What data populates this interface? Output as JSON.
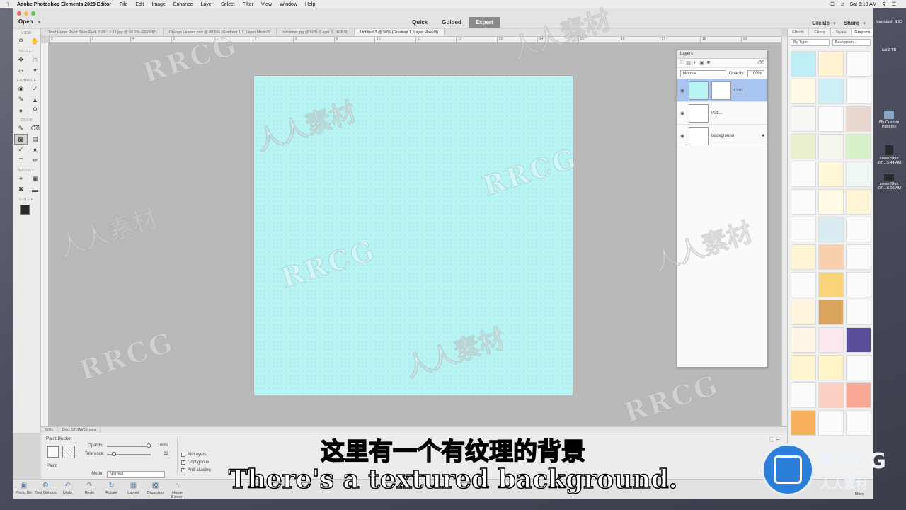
{
  "menubar": {
    "app_name": "Adobe Photoshop Elements 2020 Editor",
    "menus": [
      "File",
      "Edit",
      "Image",
      "Enhance",
      "Layer",
      "Select",
      "Filter",
      "View",
      "Window",
      "Help"
    ],
    "clock": "Sat 6:10 AM"
  },
  "header": {
    "open": "Open",
    "modes": [
      "Quick",
      "Guided",
      "Expert"
    ],
    "active_mode": "Expert",
    "create": "Create",
    "share": "Share"
  },
  "toolbox": {
    "sections": [
      "VIEW",
      "SELECT",
      "ENHANCE",
      "DRAW",
      "MODIFY",
      "COLOR"
    ]
  },
  "doc_tabs": [
    "Dead Horse Point State Park 7-28-17-11.jpg @ 66.2% (RGB/8*)",
    "Orange Leaves.psd @ 88.5% (Gradient 1.1, Layer Mask/8)",
    "Vacation.jpg @ 50% (Layer 1, RGB/8)",
    "Untitled-3 @ 50% (Gradient 1, Layer Mask/8)"
  ],
  "ruler_ticks": [
    "2",
    "3",
    "4",
    "5",
    "6",
    "7",
    "8",
    "9",
    "10",
    "11",
    "12",
    "13",
    "14",
    "15",
    "16",
    "17",
    "18",
    "19"
  ],
  "status": {
    "zoom": "50%",
    "doc": "Doc: 57.1M/0 bytes"
  },
  "layers_panel": {
    "title": "Layers",
    "blend_mode": "Normal",
    "opacity_label": "Opacity:",
    "opacity": "100%",
    "layers": [
      {
        "name": "Colo..."
      },
      {
        "name": "Patt..."
      },
      {
        "name": "Background"
      }
    ]
  },
  "right_panel": {
    "tabs": [
      "Effects",
      "Filters",
      "Styles",
      "Graphics"
    ],
    "active_tab": "Graphics",
    "filter_1": "By Type",
    "filter_2": "Backgroun...",
    "thumbnails": [
      "#bfeef6",
      "#fff3d2",
      "#fbfbfb",
      "#fffbe6",
      "#cdf0f7",
      "#fbfbfb",
      "#f7f7f4",
      "#fbfbfb",
      "#e8d6cf",
      "#e9efcf",
      "#f6f6ef",
      "#d7f0c8",
      "#fbfbfb",
      "#fff9d9",
      "#eef7f4",
      "#fbfbfb",
      "#fffbe6",
      "#fff6d6",
      "#fbfbfb",
      "#d8ecf1",
      "#fbfbfb",
      "#fff4d4",
      "#f8d0ae",
      "#fbfbfb",
      "#fbfbfb",
      "#f8d37a",
      "#fbfbfb",
      "#fff4de",
      "#d8a45e",
      "#fbfbfb",
      "#fff6e8",
      "#fbe7ee",
      "#5a4c99",
      "#fff6cf",
      "#fff3c7",
      "#fbfbfb",
      "#fbfbfb",
      "#fbd0c2",
      "#f8a895",
      "#f7b15a",
      "#fbfbfb",
      "#fbfbfb"
    ]
  },
  "tool_options": {
    "tool_name": "Paint Bucket",
    "paint_label": "Paint",
    "opacity_label": "Opacity:",
    "opacity_value": "100%",
    "opacity_fraction": 1.0,
    "tolerance_label": "Tolerance:",
    "tolerance_value": "32",
    "tolerance_fraction": 0.125,
    "mode_label": "Mode:",
    "mode_value": "Normal",
    "all_layers": "All Layers",
    "contiguous": "Contiguous",
    "anti_aliasing": "Anti-aliasing",
    "all_layers_checked": false,
    "contiguous_checked": true,
    "anti_aliasing_checked": true
  },
  "taskbar": {
    "items": [
      {
        "label": "Photo Bin",
        "icon": "photo-bin-icon"
      },
      {
        "label": "Tool Options",
        "icon": "tool-options-icon"
      },
      {
        "label": "Undo",
        "icon": "undo-icon"
      },
      {
        "label": "Redo",
        "icon": "redo-icon"
      },
      {
        "label": "Rotate",
        "icon": "rotate-icon"
      },
      {
        "label": "Layout",
        "icon": "layout-icon"
      },
      {
        "label": "Organizer",
        "icon": "organizer-icon"
      },
      {
        "label": "Home Screen",
        "icon": "home-icon"
      }
    ],
    "more": "More"
  },
  "desktop": {
    "items": [
      "Macintosh SSD",
      "nal 2 TB",
      "My Custom Patterns",
      "creen Shot -07....5.44 AM",
      "creen Shot -07....6.06 AM"
    ]
  },
  "watermark": {
    "latin": "RRCG",
    "cn": "人人素材"
  },
  "subtitle": {
    "cn": "这里有一个有纹理的背景",
    "en": "There's a textured background."
  },
  "logo": {
    "name": "RRCG",
    "cn": "人人素材"
  },
  "colors": {
    "canvas": "#b8f4f4",
    "selected_layer": "#a9c4ee",
    "logo_blue": "#2b7fd8"
  }
}
